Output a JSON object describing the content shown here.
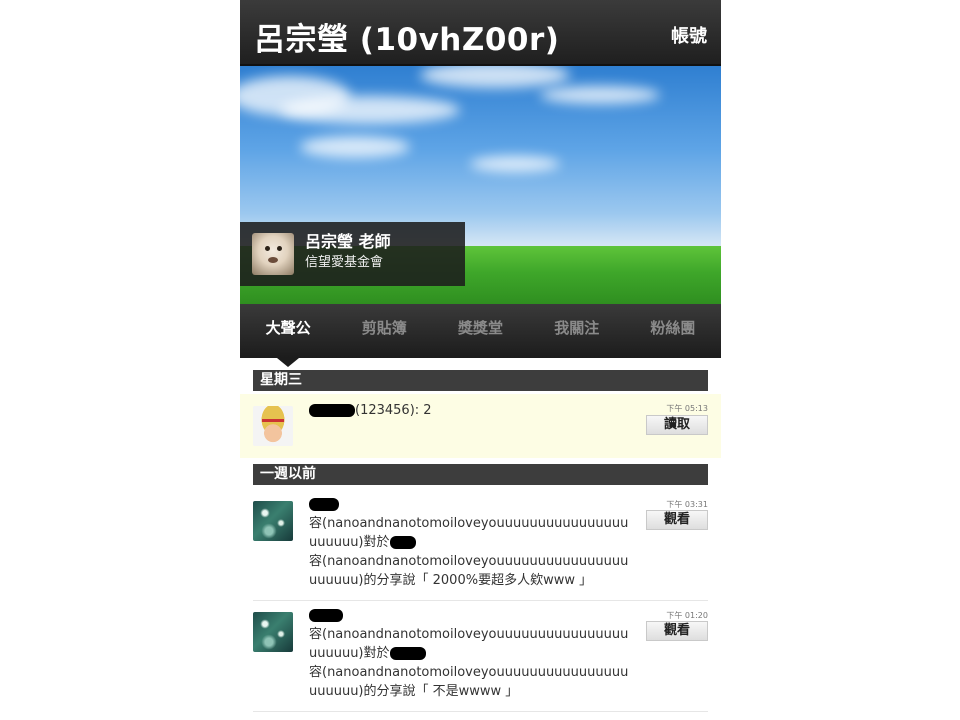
{
  "header": {
    "title": "呂宗瑩 (10vhZ00r)",
    "account_label": "帳號"
  },
  "profile": {
    "name": "呂宗瑩 老師",
    "organization": "信望愛基金會"
  },
  "tabs": [
    {
      "label": "大聲公",
      "active": true
    },
    {
      "label": "剪貼簿",
      "active": false
    },
    {
      "label": "獎獎堂",
      "active": false
    },
    {
      "label": "我關注",
      "active": false
    },
    {
      "label": "粉絲團",
      "active": false
    }
  ],
  "sections": [
    {
      "header": "星期三",
      "items": [
        {
          "text": "(123456): 2",
          "time": "下午 05:13",
          "button": "讀取"
        }
      ]
    },
    {
      "header": "一週以前",
      "items": [
        {
          "line1": "容(nanoandnanotomoiloveyouuuuuuuuuuuuuuuuuuuuuu)對於",
          "line2": "容(nanoandnanotomoiloveyouuuuuuuuuuuuuuuuuuuuuu)的分享說「 2000%要超多人欸www 」",
          "time": "下午 03:31",
          "button": "觀看"
        },
        {
          "line1": "容(nanoandnanotomoiloveyouuuuuuuuuuuuuuuuuuuuuu)對於",
          "line2": "容(nanoandnanotomoiloveyouuuuuuuuuuuuuuuuuuuuuu)的分享說「 不是wwww 」",
          "time": "下午 01:20",
          "button": "觀看"
        }
      ]
    }
  ],
  "colors": {
    "bar": "#2b2b2b",
    "section": "#3d3d3d",
    "highlight": "#fdfde4",
    "grass": "#3fa72a",
    "sky": "#5ea4e6"
  }
}
